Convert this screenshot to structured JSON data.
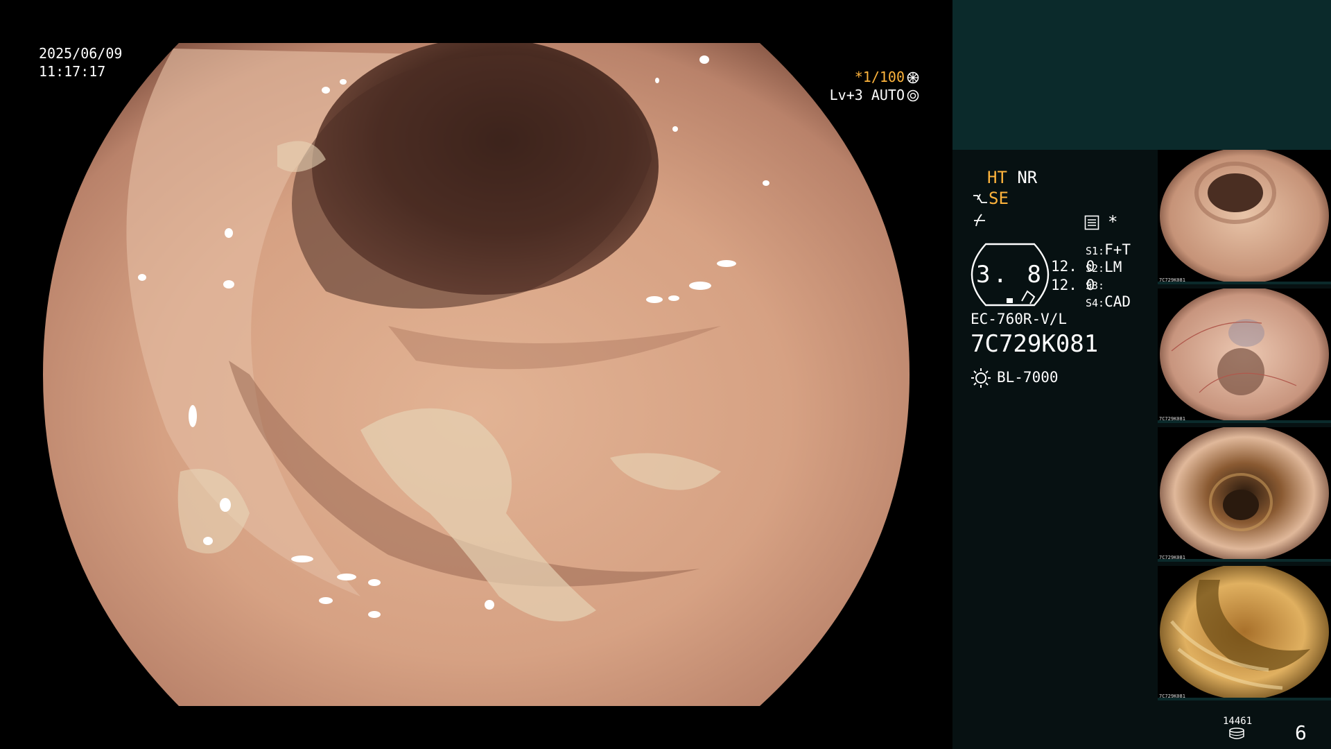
{
  "overlay": {
    "date": "2025/06/09",
    "time": "11:17:17",
    "shutter": "*1/100",
    "level": "Lv+3 AUTO"
  },
  "panel": {
    "mode_ht": "HT",
    "mode_nr": "NR",
    "mode_se": "SE",
    "asterisk": "*",
    "gauge_value": "3. 8",
    "value_a": "12. 0",
    "value_b": "12. 0",
    "slots": [
      {
        "key": "S1:",
        "value": "F+T"
      },
      {
        "key": "S2:",
        "value": "LM"
      },
      {
        "key": "S3:",
        "value": ""
      },
      {
        "key": "S4:",
        "value": "CAD"
      }
    ],
    "scope_model": "EC-760R-V/L",
    "scope_serial": "7C729K081",
    "light_source": "BL-7000"
  },
  "thumbnails": [
    {
      "label": "7C729K081",
      "tone": "pink-mucosa",
      "palette": [
        "#e8c4a8",
        "#b78366",
        "#4a2e22"
      ]
    },
    {
      "label": "7C729K081",
      "tone": "pink-vascular",
      "palette": [
        "#e9c2ad",
        "#c08f78",
        "#5a3a2e"
      ]
    },
    {
      "label": "7C729K081",
      "tone": "dark-lumen",
      "palette": [
        "#e0b89a",
        "#8a5a32",
        "#2a1a0e"
      ]
    },
    {
      "label": "7C729K081",
      "tone": "yellow-residue",
      "palette": [
        "#e0b060",
        "#a8702a",
        "#4a3010"
      ]
    }
  ],
  "footer": {
    "storage_count": "14461",
    "page_number": "6"
  },
  "colors": {
    "panel_bg": "#071112",
    "panel_top": "#0b2a2b",
    "accent_amber": "#ffb43c",
    "mucosa": "#d9a687"
  }
}
